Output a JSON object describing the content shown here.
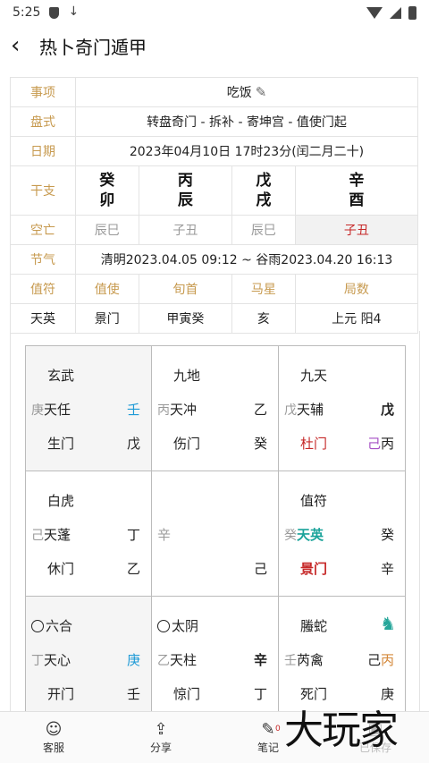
{
  "status": {
    "time": "5:25"
  },
  "header": {
    "title": "热卜奇门遁甲"
  },
  "info": {
    "item_label": "事项",
    "item_value": "吃饭",
    "pan_label": "盘式",
    "pan_value": "转盘奇门 - 拆补 - 寄坤宫 - 值使门起",
    "date_label": "日期",
    "date_value": "2023年04月10日 17时23分(闰二月二十)",
    "ganzhi_label": "干支",
    "ganzhi": [
      {
        "top": "癸",
        "bottom": "卯"
      },
      {
        "top": "丙",
        "bottom": "辰"
      },
      {
        "top": "戊",
        "bottom": "戌"
      },
      {
        "top": "辛",
        "bottom": "酉"
      }
    ],
    "kongwang_label": "空亡",
    "kongwang": [
      "辰巳",
      "子丑",
      "辰巳",
      "子丑"
    ],
    "jieqi_label": "节气",
    "jieqi_value": "清明2023.04.05 09:12 ~ 谷雨2023.04.20 16:13",
    "headers": [
      "值符",
      "值使",
      "旬首",
      "马星",
      "局数"
    ],
    "values": [
      "天英",
      "景门",
      "甲寅癸",
      "亥",
      "上元 阳4"
    ]
  },
  "board": {
    "p1": {
      "god": "玄武",
      "hs": "庚",
      "star": "天任",
      "tr1": "壬",
      "door": "生门",
      "tr2": "戊"
    },
    "p2": {
      "god": "九地",
      "hs": "丙",
      "star": "天冲",
      "tr1": "乙",
      "door": "伤门",
      "tr2": "癸"
    },
    "p3": {
      "god": "九天",
      "hs": "戊",
      "star": "天辅",
      "tr1": "戊",
      "door": "杜门",
      "tr2a": "己",
      "tr2b": "丙"
    },
    "p4": {
      "god": "白虎",
      "hs": "己",
      "star": "天蓬",
      "tr1": "丁",
      "door": "休门",
      "tr2": "乙"
    },
    "p5": {
      "top": "辛",
      "bottom": "己"
    },
    "p6": {
      "god": "值符",
      "hs": "癸",
      "star": "天英",
      "tr1": "癸",
      "door": "景门",
      "tr2": "辛"
    },
    "p7": {
      "god": "六合",
      "hs": "丁",
      "star": "天心",
      "tr1": "庚",
      "door": "开门",
      "tr2": "壬"
    },
    "p8": {
      "god": "太阴",
      "hs": "乙",
      "star": "天柱",
      "tr1": "辛",
      "door": "惊门",
      "tr2": "丁"
    },
    "p9": {
      "god": "螣蛇",
      "hs": "壬",
      "star": "芮禽",
      "tr1a": "己",
      "tr1b": "丙",
      "door": "死门",
      "tr2": "庚"
    }
  },
  "bottom": {
    "service": "客服",
    "share": "分享",
    "notes": "笔记",
    "notes_badge": "0",
    "saved": "已保存"
  },
  "watermark": "大玩家",
  "icons": {
    "back": "back-arrow-icon",
    "edit": "pencil-icon",
    "horse": "horse-icon"
  },
  "colors": {
    "label": "#c79a4f",
    "red": "#c62828",
    "blue": "#1e9ad6",
    "teal": "#1aa39a",
    "purple": "#a64fc4",
    "orange": "#d4883a"
  }
}
